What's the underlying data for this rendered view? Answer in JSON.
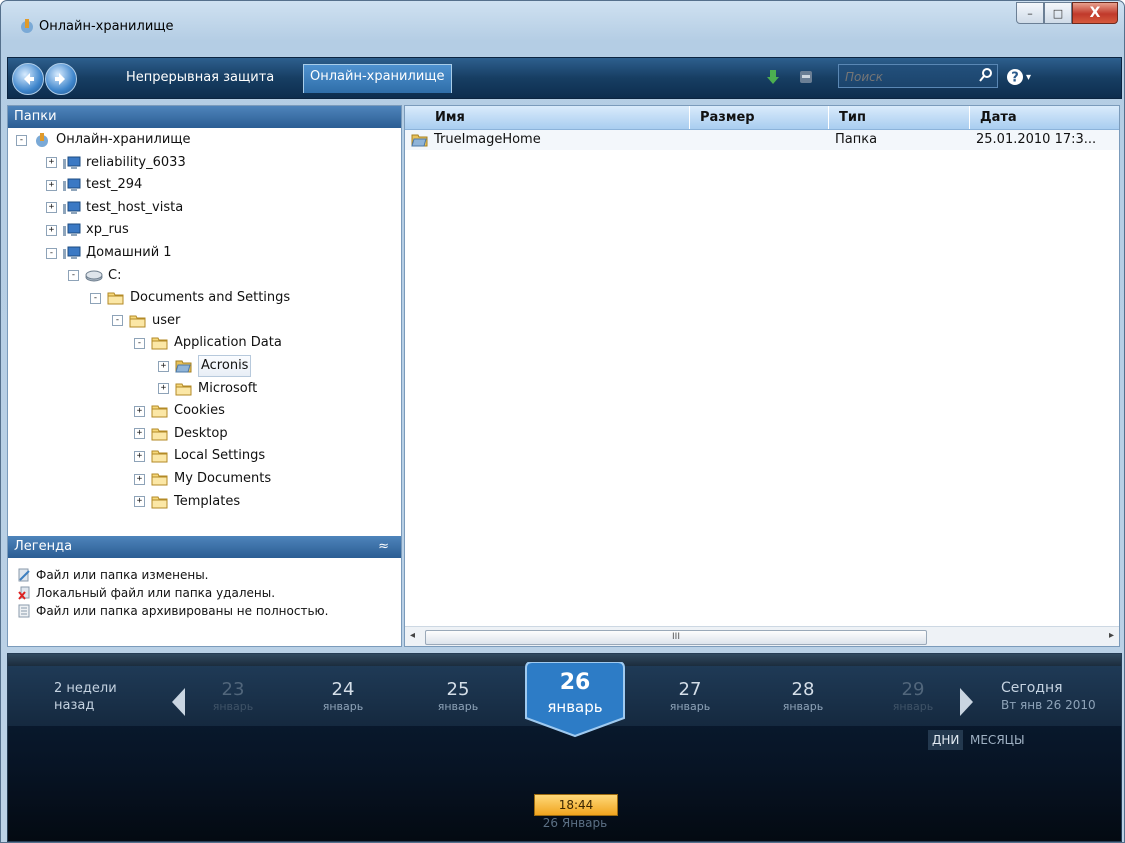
{
  "window": {
    "title": "Онлайн-хранилище",
    "minimize": "–",
    "maximize": "□",
    "close": "X"
  },
  "toolbar": {
    "tabs": [
      {
        "label": "Непрерывная защита"
      },
      {
        "label": "Онлайн-хранилище"
      }
    ],
    "search_placeholder": "Поиск",
    "help_caret": "▾"
  },
  "folders": {
    "header": "Папки",
    "tree": [
      {
        "label": "Онлайн-хранилище",
        "toggle": "-",
        "icon": "storage-icon"
      },
      {
        "label": "reliability_6033",
        "toggle": "+",
        "icon": "computer-icon"
      },
      {
        "label": "test_294",
        "toggle": "+",
        "icon": "computer-icon"
      },
      {
        "label": "test_host_vista",
        "toggle": "+",
        "icon": "computer-icon"
      },
      {
        "label": "xp_rus",
        "toggle": "+",
        "icon": "computer-icon"
      },
      {
        "label": "Домашний 1",
        "toggle": "-",
        "icon": "computer-icon"
      },
      {
        "label": "C:",
        "toggle": "-",
        "icon": "drive-icon"
      },
      {
        "label": "Documents and Settings",
        "toggle": "-",
        "icon": "folder-icon"
      },
      {
        "label": "user",
        "toggle": "-",
        "icon": "folder-icon"
      },
      {
        "label": "Application Data",
        "toggle": "-",
        "icon": "folder-icon"
      },
      {
        "label": "Acronis",
        "toggle": "+",
        "icon": "folder-archived-icon"
      },
      {
        "label": "Microsoft",
        "toggle": "+",
        "icon": "folder-icon"
      },
      {
        "label": "Cookies",
        "toggle": "+",
        "icon": "folder-icon"
      },
      {
        "label": "Desktop",
        "toggle": "+",
        "icon": "folder-icon"
      },
      {
        "label": "Local Settings",
        "toggle": "+",
        "icon": "folder-icon"
      },
      {
        "label": "My Documents",
        "toggle": "+",
        "icon": "folder-icon"
      },
      {
        "label": "Templates",
        "toggle": "+",
        "icon": "folder-icon"
      }
    ]
  },
  "legend": {
    "header": "Легенда",
    "collapse": "≈",
    "items": [
      {
        "label": "Файл или папка изменены.",
        "icon": "modified-icon"
      },
      {
        "label": "Локальный файл или папка удалены.",
        "icon": "deleted-icon"
      },
      {
        "label": "Файл или папка архивированы не полностью.",
        "icon": "partial-icon"
      }
    ]
  },
  "filelist": {
    "columns": [
      "Имя",
      "Размер",
      "Тип",
      "Дата"
    ],
    "rows": [
      {
        "name": "TrueImageHome",
        "size": "",
        "type": "Папка",
        "date": "25.01.2010 17:3..."
      }
    ],
    "scroll_grip": "III",
    "scroll_left": "◂",
    "scroll_right": "▸"
  },
  "timeline": {
    "back_label_1": "2 недели",
    "back_label_2": "назад",
    "days": [
      {
        "num": "23",
        "mon": "январь"
      },
      {
        "num": "24",
        "mon": "январь"
      },
      {
        "num": "25",
        "mon": "январь"
      },
      {
        "num": "27",
        "mon": "январь"
      },
      {
        "num": "28",
        "mon": "январь"
      },
      {
        "num": "29",
        "mon": "январь"
      }
    ],
    "selected": {
      "num": "26",
      "mon": "январь"
    },
    "today_1": "Сегодня",
    "today_2": "Вт янв 26 2010",
    "modes": [
      "ДНИ",
      "МЕСЯЦЫ"
    ],
    "time": "18:44",
    "time_date": "26 Январь"
  }
}
